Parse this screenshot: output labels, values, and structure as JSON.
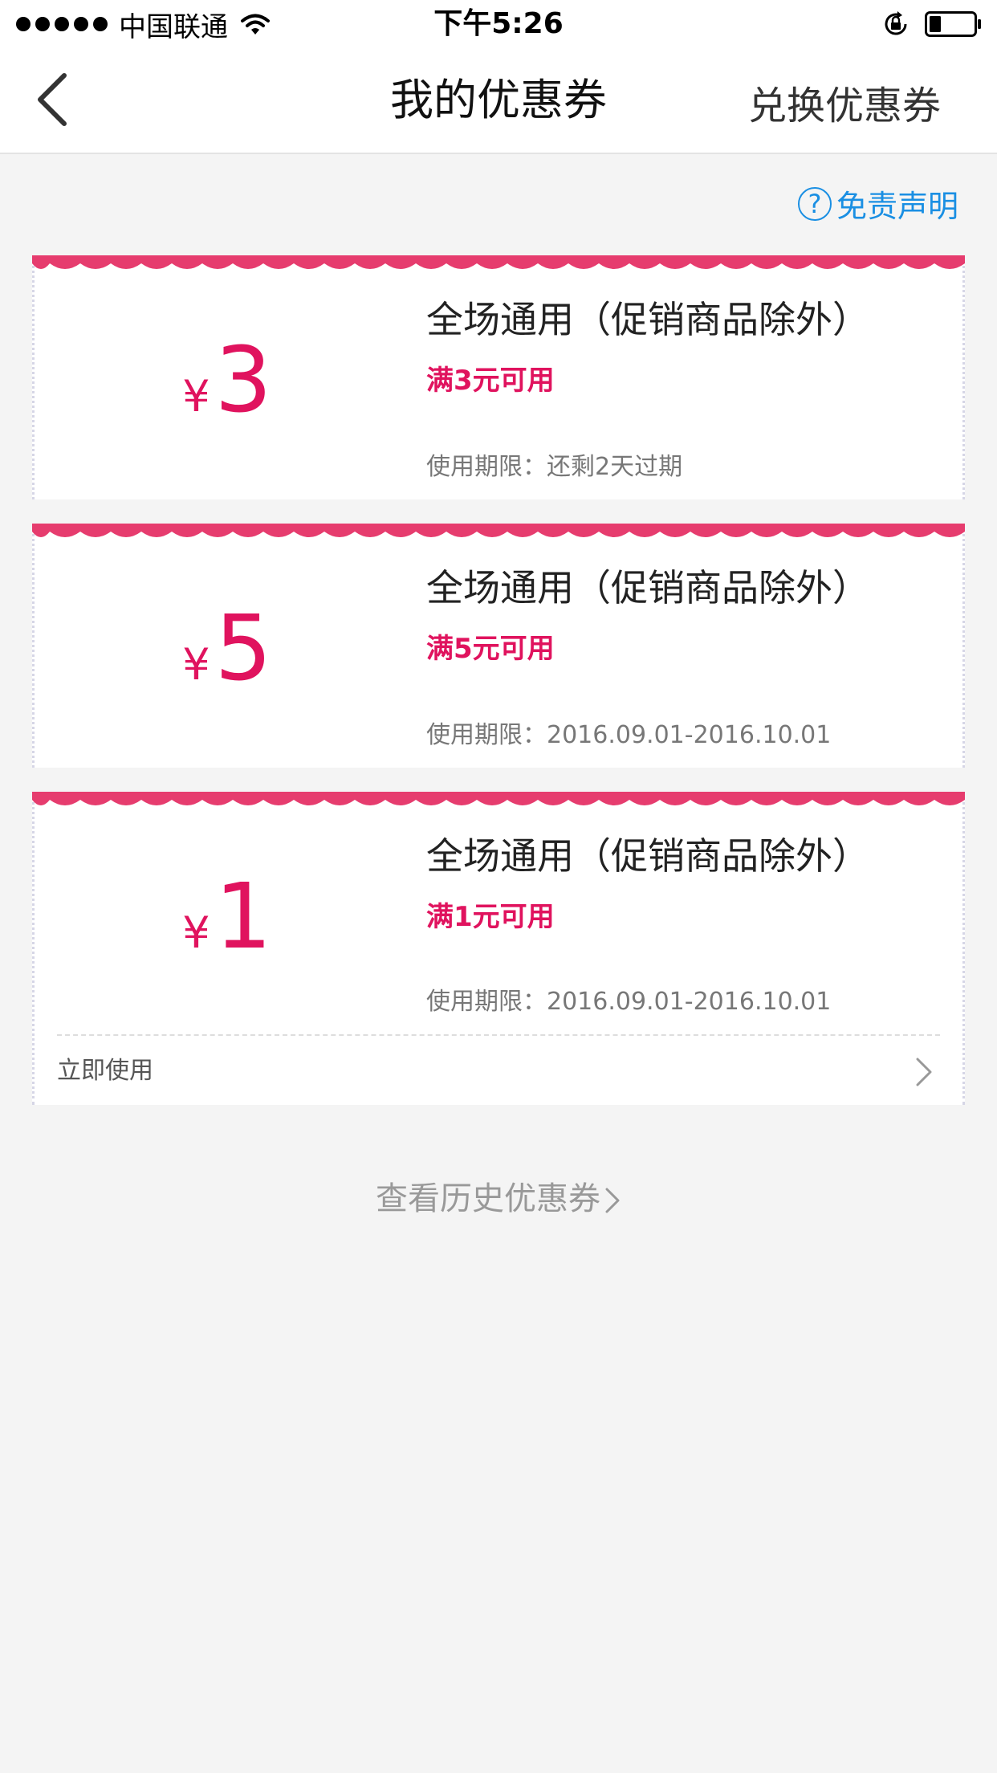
{
  "status_bar": {
    "carrier": "中国联通",
    "time": "下午5:26"
  },
  "navbar": {
    "title": "我的优惠券",
    "right_action": "兑换优惠券"
  },
  "disclaimer": {
    "icon_glyph": "?",
    "label": "免责声明"
  },
  "coupons": [
    {
      "currency": "¥",
      "amount": "3",
      "title": "全场通用（促销商品除外）",
      "condition": "满3元可用",
      "validity": "使用期限：还剩2天过期"
    },
    {
      "currency": "¥",
      "amount": "5",
      "title": "全场通用（促销商品除外）",
      "condition": "满5元可用",
      "validity": "使用期限：2016.09.01-2016.10.01"
    },
    {
      "currency": "¥",
      "amount": "1",
      "title": "全场通用（促销商品除外）",
      "condition": "满1元可用",
      "validity": "使用期限：2016.09.01-2016.10.01",
      "action_label": "立即使用"
    }
  ],
  "history_link": "查看历史优惠券",
  "colors": {
    "accent": "#e0135e",
    "wave": "#e63c6e",
    "link": "#1a8fe3",
    "background": "#f4f4f4"
  }
}
